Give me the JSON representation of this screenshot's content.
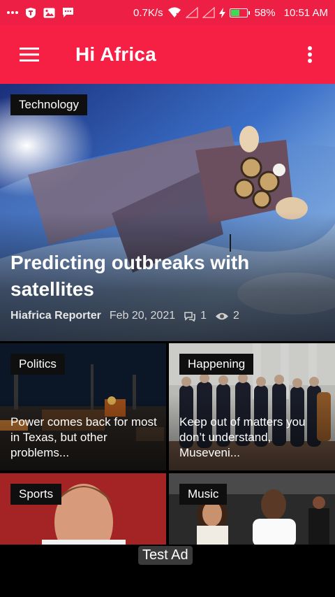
{
  "status_bar": {
    "speed": "0.7K/s",
    "battery_percent": "58%",
    "battery_level": 0.58,
    "time": "10:51 AM",
    "icons": [
      "more-dots-icon",
      "shield-icon",
      "image-icon",
      "message-icon",
      "wifi-icon",
      "signal-icon",
      "signal-icon",
      "charging-icon",
      "battery-icon"
    ]
  },
  "app_bar": {
    "title": "Hi Africa",
    "menu_icon": "hamburger-menu-icon",
    "overflow_icon": "more-vert-icon"
  },
  "featured": {
    "category": "Technology",
    "title": "Predicting outbreaks with satellites",
    "author": "Hiafrica Reporter",
    "date": "Feb 20, 2021",
    "comments": "1",
    "views": "2"
  },
  "articles": [
    {
      "category": "Politics",
      "title": "Power comes back for most in Texas, but other problems..."
    },
    {
      "category": "Happening",
      "title": "Keep out of matters you don’t understand, Museveni..."
    },
    {
      "category": "Sports",
      "title": ""
    },
    {
      "category": "Music",
      "title": ""
    }
  ],
  "ad": {
    "label": "Test Ad"
  },
  "colors": {
    "primary": "#f61f44",
    "status_bar": "#ee1f45",
    "tag_bg": "#0f0f0f"
  }
}
